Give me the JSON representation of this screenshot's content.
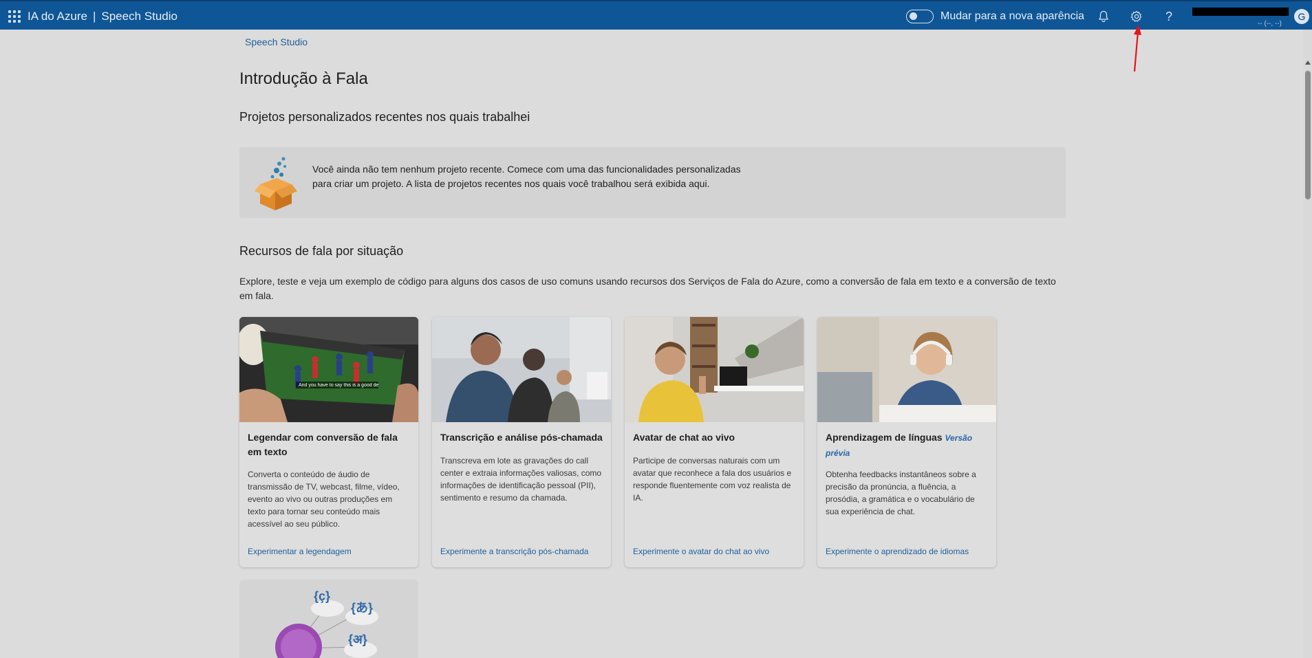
{
  "header": {
    "app": "IA do Azure",
    "separator": "|",
    "product": "Speech Studio",
    "toggle_label": "Mudar para a nova aparência",
    "account_sub": "-- (--, --)",
    "avatar_initial": "G"
  },
  "breadcrumb": "Speech Studio",
  "page_title": "Introdução à Fala",
  "recent": {
    "title": "Projetos personalizados recentes nos quais trabalhei",
    "empty_message": "Você ainda não tem nenhum projeto recente. Comece com uma das funcionalidades personalizadas para criar um projeto. A lista de projetos recentes nos quais você trabalhou será exibida aqui."
  },
  "resources": {
    "title": "Recursos de fala por situação",
    "intro": "Explore, teste e veja um exemplo de código para alguns dos casos de uso comuns usando recursos dos Serviços de Fala do Azure, como a conversão de fala em texto e a conversão de texto em fala."
  },
  "cards": [
    {
      "title": "Legendar com conversão de fala em texto",
      "description": "Converta o conteúdo de áudio de transmissão de TV, webcast, filme, vídeo, evento ao vivo ou outras produções em texto para tornar seu conteúdo mais acessível ao seu público.",
      "link": "Experimentar a legendagem",
      "image_caption": "And you have to say this is a good defense."
    },
    {
      "title": "Transcrição e análise pós-chamada",
      "description": "Transcreva em lote as gravações do call center e extraia informações valiosas, como informações de identificação pessoal (PII), sentimento e resumo da chamada.",
      "link": "Experimente a transcrição pós-chamada"
    },
    {
      "title": "Avatar de chat ao vivo",
      "description": "Participe de conversas naturais com um avatar que reconhece a fala dos usuários e responde fluentemente com voz realista de IA.",
      "link": "Experimente o avatar do chat ao vivo"
    },
    {
      "title": "Aprendizagem de línguas",
      "badge": "Versão prévia",
      "description": "Obtenha feedbacks instantâneos sobre a precisão da pronúncia, a fluência, a prosódia, a gramática e o vocabulário de sua experiência de chat.",
      "link": "Experimente o aprendizado de idiomas"
    }
  ],
  "card5_glyphs": [
    "{ç}",
    "{あ}",
    "{अ}"
  ],
  "colors": {
    "header_bg": "#0f5696",
    "link": "#1f5e9c",
    "annotation": "#e8141b"
  }
}
